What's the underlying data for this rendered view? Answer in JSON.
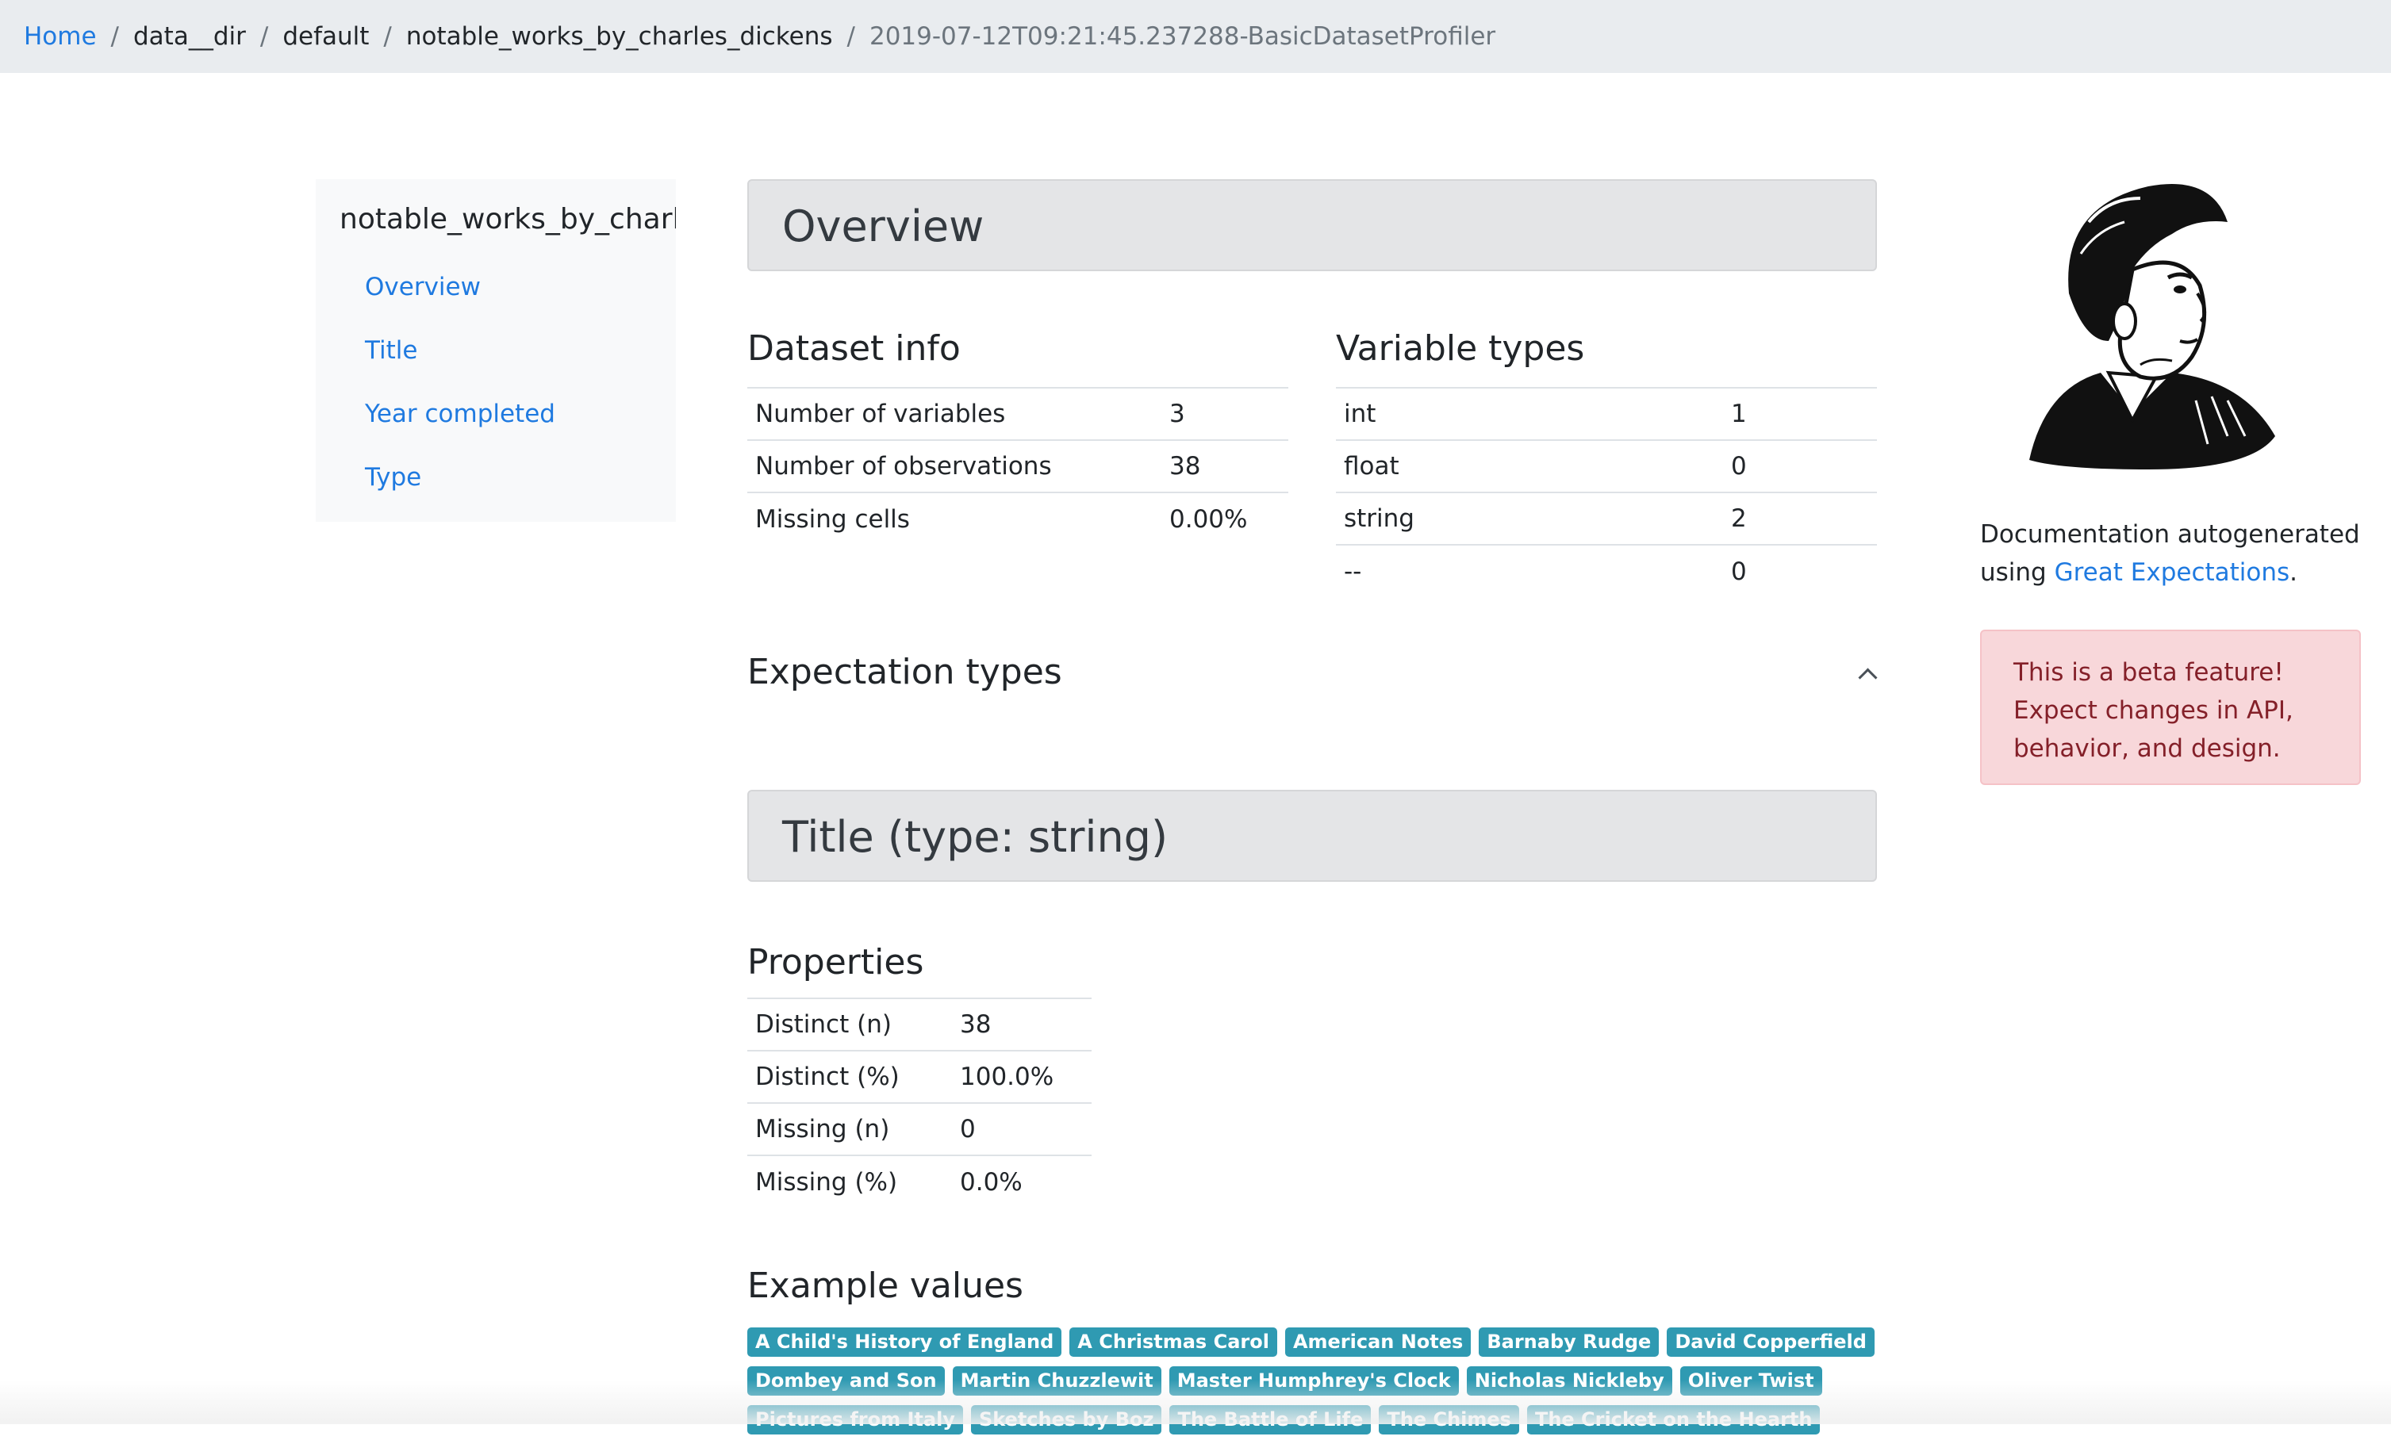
{
  "breadcrumb": {
    "items": [
      "Home",
      "data__dir",
      "default",
      "notable_works_by_charles_dickens",
      "2019-07-12T09:21:45.237288-BasicDatasetProfiler"
    ],
    "separator": "/"
  },
  "sidebar": {
    "title": "notable_works_by_charles_dickens",
    "items": [
      "Overview",
      "Title",
      "Year completed",
      "Type"
    ]
  },
  "overview": {
    "heading": "Overview",
    "dataset_info": {
      "title": "Dataset info",
      "rows": [
        [
          "Number of variables",
          "3"
        ],
        [
          "Number of observations",
          "38"
        ],
        [
          "Missing cells",
          "0.00%"
        ]
      ]
    },
    "variable_types": {
      "title": "Variable types",
      "rows": [
        [
          "int",
          "1"
        ],
        [
          "float",
          "0"
        ],
        [
          "string",
          "2"
        ],
        [
          "--",
          "0"
        ]
      ]
    },
    "expectation_types_title": "Expectation types"
  },
  "title_section": {
    "heading": "Title (type: string)",
    "properties_title": "Properties",
    "properties": [
      [
        "Distinct (n)",
        "38"
      ],
      [
        "Distinct (%)",
        "100.0%"
      ],
      [
        "Missing (n)",
        "0"
      ],
      [
        "Missing (%)",
        "0.0%"
      ]
    ],
    "example_values_title": "Example values",
    "example_values": [
      [
        "A Child's History of England",
        "A Christmas Carol",
        "American Notes",
        "Barnaby Rudge",
        "David Copperfield"
      ],
      [
        "Dombey and Son",
        "Martin Chuzzlewit",
        "Master Humphrey's Clock",
        "Nicholas Nickleby",
        "Oliver Twist"
      ],
      [
        "Pictures from Italy",
        "Sketches by Boz",
        "The Battle of Life",
        "The Chimes",
        "The Cricket on the Hearth"
      ]
    ]
  },
  "right_panel": {
    "doc_note_prefix": "Documentation autogenerated using ",
    "doc_note_link": "Great Expectations",
    "doc_note_suffix": ".",
    "beta_alert": "This is a beta feature! Expect changes in API, behavior, and design."
  },
  "colors": {
    "link": "#1f7ae0",
    "badge": "#2f9ab2",
    "alert_bg": "#f8d7da",
    "alert_text": "#842029",
    "breadcrumb_bg": "#e9ecef"
  }
}
